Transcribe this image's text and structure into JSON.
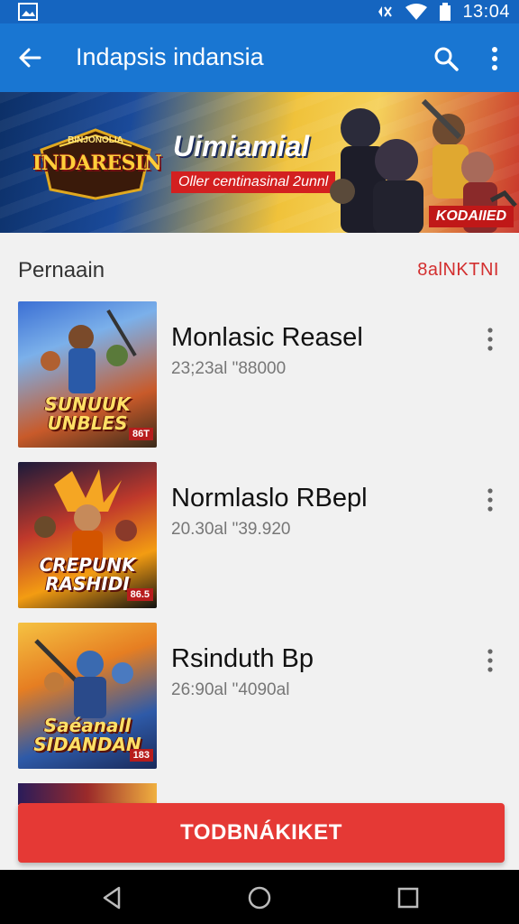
{
  "status_bar": {
    "time": "13:04",
    "icons": [
      "gallery-icon",
      "mute-icon",
      "wifi-icon",
      "battery-icon"
    ]
  },
  "app_bar": {
    "title": "Indapsis indansia",
    "icons": [
      "back-arrow-icon",
      "search-icon",
      "more-vert-icon"
    ]
  },
  "banner": {
    "logo_subtitle": "BINJONOLIA",
    "logo_title": "INDARESIN",
    "headline": "Uimiamial",
    "subheadline": "Oller centinasinal 2unnl",
    "badge": "KODAIIED"
  },
  "section": {
    "title": "Pernaain",
    "action": "8alNKTNI"
  },
  "games": [
    {
      "name": "Monlasic Reasel",
      "meta": "23;23al \"88000",
      "cover_text": "SUNUUK\nUNBLES",
      "cover_tag": "86T"
    },
    {
      "name": "Normlaslo RBepl",
      "meta": "20.30al \"39.920",
      "cover_text": "CREPUNK\nRASHIDI",
      "cover_tag": "86.5"
    },
    {
      "name": "Rsinduth Bp",
      "meta": "26:90al \"4090al",
      "cover_text": "Saéanall\nSIDANDAN",
      "cover_tag": "183"
    }
  ],
  "primary_button": {
    "label": "TODBNÁKIKET"
  },
  "colors": {
    "status_bar": "#1565c0",
    "app_bar": "#1976d2",
    "accent_red": "#e53935",
    "section_action": "#d32f2f",
    "background": "#f1f1f1"
  }
}
